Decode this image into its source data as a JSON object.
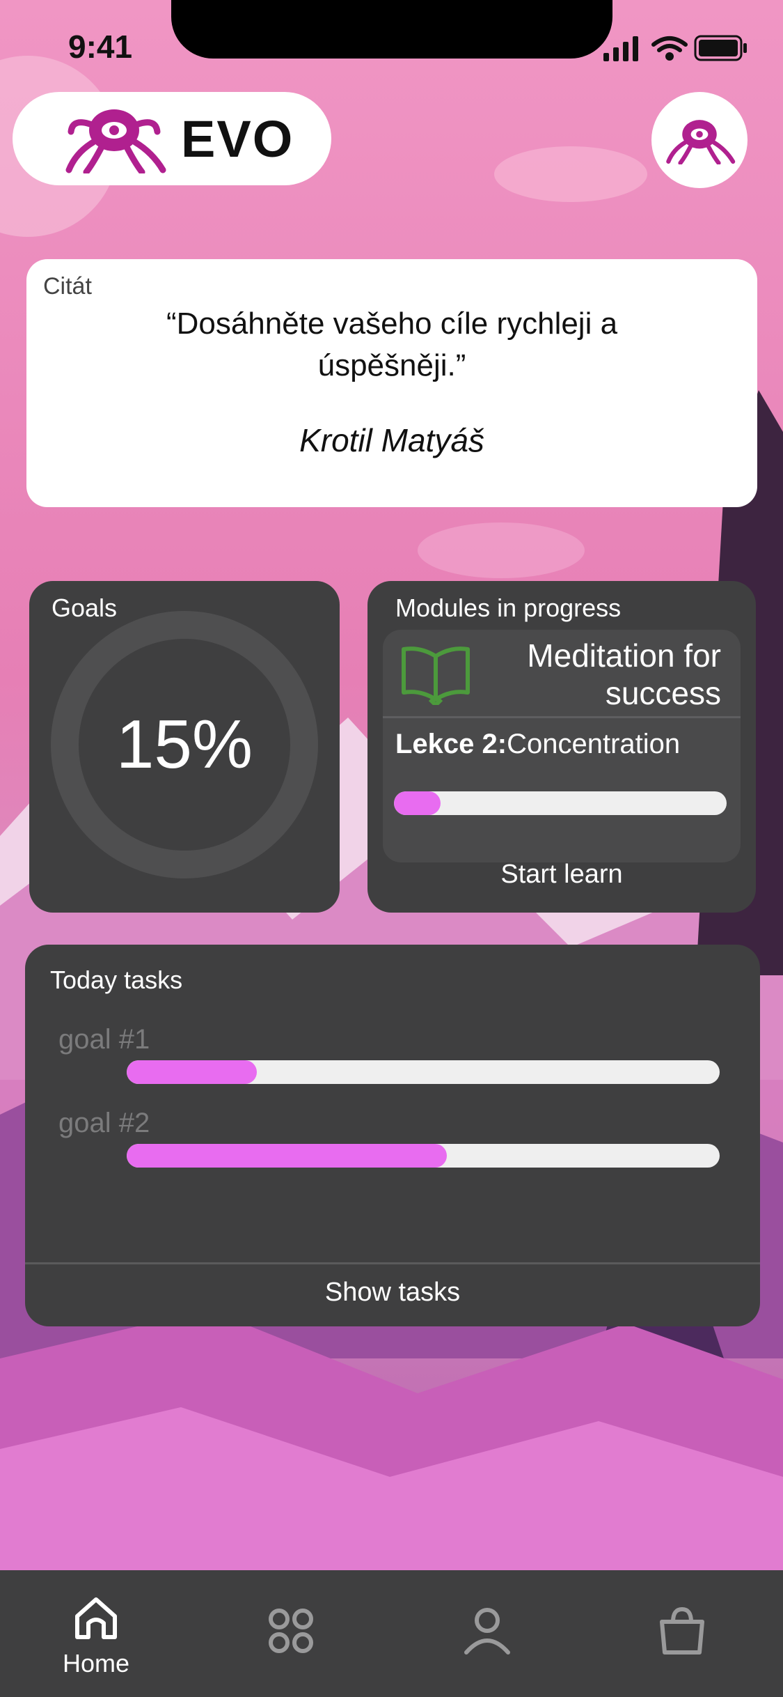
{
  "status_bar": {
    "time": "9:41"
  },
  "header": {
    "brand": "EVO"
  },
  "quote": {
    "label": "Citát",
    "text": "“Dosáhněte vašeho cíle rychleji a úspěšněji.”",
    "author": "Krotil Matyáš"
  },
  "goals": {
    "title": "Goals",
    "percent_label": "15%",
    "percent_value": 15
  },
  "modules": {
    "title": "Modules in progress",
    "module_name": "Meditation for success",
    "lesson_prefix": "Lekce 2:",
    "lesson_name": "Concentration",
    "progress": 0.14,
    "action": "Start learn"
  },
  "tasks": {
    "title": "Today tasks",
    "items": [
      {
        "label": "goal #1",
        "progress": 0.22
      },
      {
        "label": "goal #2",
        "progress": 0.54
      }
    ],
    "action": "Show tasks"
  },
  "nav": {
    "items": [
      {
        "label": "Home",
        "icon": "home-icon",
        "active": true
      },
      {
        "label": "",
        "icon": "apps-icon",
        "active": false
      },
      {
        "label": "",
        "icon": "profile-icon",
        "active": false
      },
      {
        "label": "",
        "icon": "shop-bag-icon",
        "active": false
      }
    ]
  },
  "colors": {
    "accent": "#e86cf0",
    "card_dark": "#3f3f40",
    "book_icon": "#4c9a3c",
    "ring": "#4f4f50"
  }
}
